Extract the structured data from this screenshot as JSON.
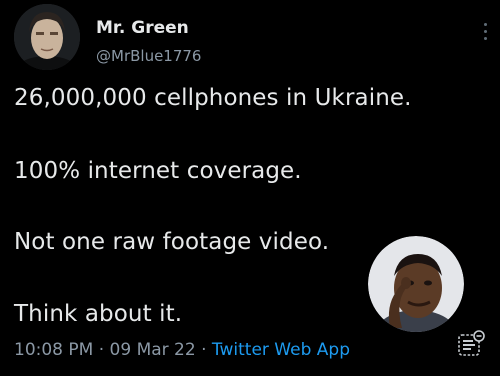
{
  "tweet": {
    "display_name": "Mr. Green",
    "handle": "@MrBlue1776",
    "lines": [
      "26,000,000 cellphones in Ukraine.",
      "100% internet coverage.",
      "Not one raw footage video.",
      "Think about it."
    ],
    "time": "10:08 PM",
    "separator1": " · ",
    "date": "09 Mar 22",
    "separator2": " · ",
    "source": "Twitter Web App"
  },
  "icons": {
    "more": "more-vertical-icon",
    "analytics": "analytics-icon"
  },
  "colors": {
    "background": "#000000",
    "text": "#e7e9ea",
    "secondary": "#8b98a5",
    "link": "#1d9bf0"
  }
}
